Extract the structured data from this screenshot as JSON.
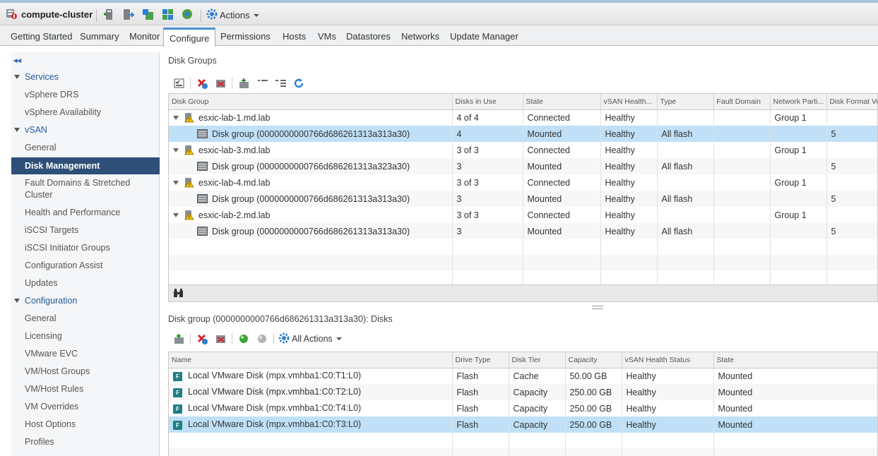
{
  "header": {
    "title": "compute-cluster",
    "actions_label": "Actions"
  },
  "tabs": [
    "Getting Started",
    "Summary",
    "Monitor",
    "Configure",
    "Permissions",
    "Hosts",
    "VMs",
    "Datastores",
    "Networks",
    "Update Manager"
  ],
  "sidebar": {
    "services": {
      "label": "Services",
      "items": [
        "vSphere DRS",
        "vSphere Availability"
      ]
    },
    "vsan": {
      "label": "vSAN",
      "items": [
        "General",
        "Disk Management",
        "Fault Domains & Stretched Cluster",
        "Health and Performance",
        "iSCSI Targets",
        "iSCSI Initiator Groups",
        "Configuration Assist",
        "Updates"
      ]
    },
    "configuration": {
      "label": "Configuration",
      "items": [
        "General",
        "Licensing",
        "VMware EVC",
        "VM/Host Groups",
        "VM/Host Rules",
        "VM Overrides",
        "Host Options",
        "Profiles"
      ]
    },
    "selected": "Disk Management"
  },
  "disk_groups": {
    "title": "Disk Groups",
    "columns": [
      "Disk Group",
      "Disks in Use",
      "State",
      "vSAN Health...",
      "Type",
      "Fault Domain",
      "Network Parti...",
      "Disk Format Ve"
    ],
    "rows": [
      {
        "name": "esxic-lab-1.md.lab",
        "disks": "4 of 4",
        "state": "Connected",
        "health": "Healthy",
        "type": "",
        "fault": "",
        "network": "Group 1",
        "format": ""
      },
      {
        "name": "Disk group (0000000000766d686261313a313a30)",
        "disks": "4",
        "state": "Mounted",
        "health": "Healthy",
        "type": "All flash",
        "fault": "",
        "network": "",
        "format": "5"
      },
      {
        "name": "esxic-lab-3.md.lab",
        "disks": "3 of 3",
        "state": "Connected",
        "health": "Healthy",
        "type": "",
        "fault": "",
        "network": "Group 1",
        "format": ""
      },
      {
        "name": "Disk group (0000000000766d686261313a323a30)",
        "disks": "3",
        "state": "Mounted",
        "health": "Healthy",
        "type": "All flash",
        "fault": "",
        "network": "",
        "format": "5"
      },
      {
        "name": "esxic-lab-4.md.lab",
        "disks": "3 of 3",
        "state": "Connected",
        "health": "Healthy",
        "type": "",
        "fault": "",
        "network": "Group 1",
        "format": ""
      },
      {
        "name": "Disk group (0000000000766d686261313a313a30)",
        "disks": "3",
        "state": "Mounted",
        "health": "Healthy",
        "type": "All flash",
        "fault": "",
        "network": "",
        "format": "5"
      },
      {
        "name": "esxic-lab-2.md.lab",
        "disks": "3 of 3",
        "state": "Connected",
        "health": "Healthy",
        "type": "",
        "fault": "",
        "network": "Group 1",
        "format": ""
      },
      {
        "name": "Disk group (0000000000766d686261313a313a30)",
        "disks": "3",
        "state": "Mounted",
        "health": "Healthy",
        "type": "All flash",
        "fault": "",
        "network": "",
        "format": "5"
      }
    ]
  },
  "disks": {
    "title": "Disk group (0000000000766d686261313a313a30): Disks",
    "all_actions_label": "All Actions",
    "columns": [
      "Name",
      "Drive Type",
      "Disk Tier",
      "Capacity",
      "vSAN Health Status",
      "State"
    ],
    "rows": [
      {
        "name": "Local VMware Disk (mpx.vmhba1:C0:T1:L0)",
        "drive": "Flash",
        "tier": "Cache",
        "capacity": "50.00 GB",
        "health": "Healthy",
        "state": "Mounted"
      },
      {
        "name": "Local VMware Disk (mpx.vmhba1:C0:T2:L0)",
        "drive": "Flash",
        "tier": "Capacity",
        "capacity": "250.00 GB",
        "health": "Healthy",
        "state": "Mounted"
      },
      {
        "name": "Local VMware Disk (mpx.vmhba1:C0:T4:L0)",
        "drive": "Flash",
        "tier": "Capacity",
        "capacity": "250.00 GB",
        "health": "Healthy",
        "state": "Mounted"
      },
      {
        "name": "Local VMware Disk (mpx.vmhba1:C0:T3:L0)",
        "drive": "Flash",
        "tier": "Capacity",
        "capacity": "250.00 GB",
        "health": "Healthy",
        "state": "Mounted"
      }
    ]
  },
  "colors": {
    "accent": "#4a90d2",
    "selected_nav": "#2d4f78",
    "selected_row": "#bfe0f7",
    "warning": "#f2c200",
    "refresh": "#2d7fd3",
    "remove": "#d8262a",
    "ok_green": "#3aa635"
  }
}
